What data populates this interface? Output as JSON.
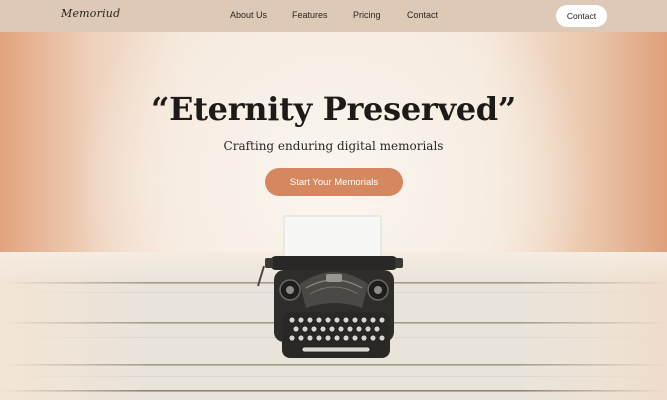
{
  "header": {
    "logo": "Memoriud",
    "nav": [
      "About Us",
      "Features",
      "Pricing",
      "Contact"
    ],
    "contact_button": "Contact"
  },
  "hero": {
    "title": "“Eternity Preserved”",
    "subtitle": "Crafting enduring digital memorials",
    "cta": "Start Your Memorials"
  },
  "colors": {
    "header_bg": "#ddc9b6",
    "accent": "#d5875f",
    "text_dark": "#1d1a17"
  },
  "icons": [
    "typewriter-illustration"
  ]
}
